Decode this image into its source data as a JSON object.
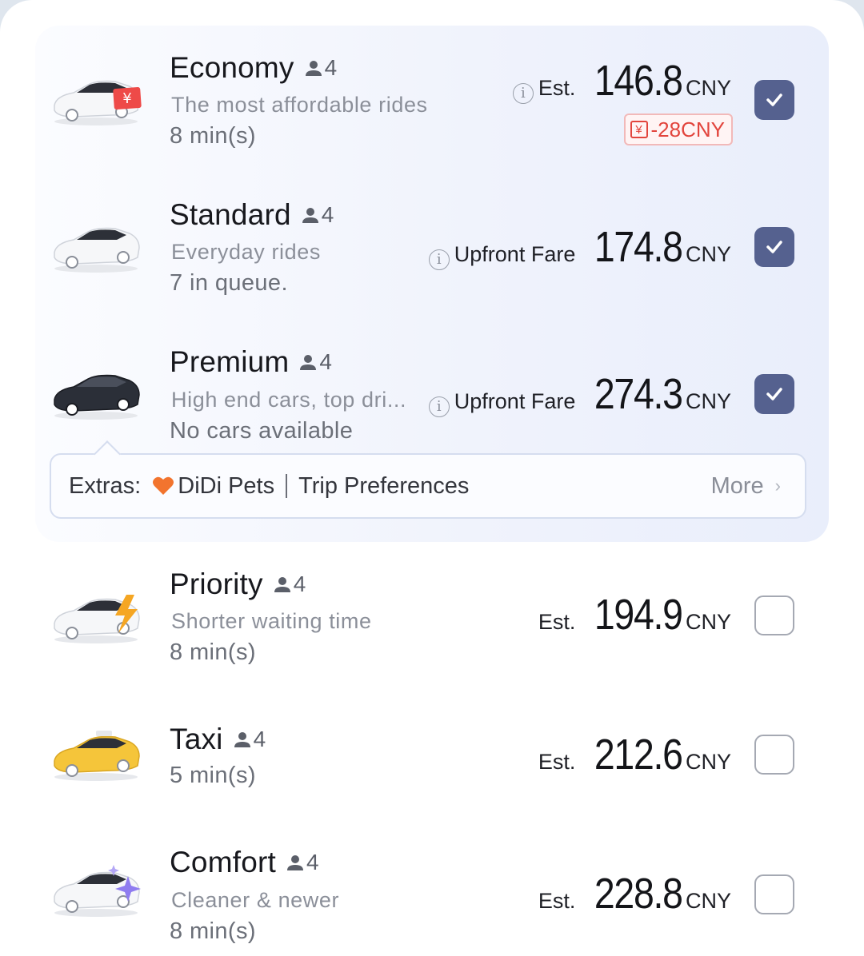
{
  "rides": [
    {
      "name": "Economy",
      "seats": "4",
      "subtitle": "The most affordable rides",
      "eta": "8 min(s)",
      "price_label": "Est.",
      "amount": "146.8",
      "currency": "CNY",
      "discount": "-28CNY",
      "discount_icon": "¥",
      "selected": true
    },
    {
      "name": "Standard",
      "seats": "4",
      "subtitle": "Everyday rides",
      "eta": "7 in queue.",
      "price_label": "Upfront Fare",
      "amount": "174.8",
      "currency": "CNY",
      "selected": true
    },
    {
      "name": "Premium",
      "seats": "4",
      "subtitle": "High end cars, top dri...",
      "eta": "No cars available",
      "price_label": "Upfront Fare",
      "amount": "274.3",
      "currency": "CNY",
      "selected": true
    },
    {
      "name": "Priority",
      "seats": "4",
      "subtitle": "Shorter waiting time",
      "eta": "8 min(s)",
      "price_label": "Est.",
      "amount": "194.9",
      "currency": "CNY",
      "selected": false
    },
    {
      "name": "Taxi",
      "seats": "4",
      "eta": "5 min(s)",
      "price_label": "Est.",
      "amount": "212.6",
      "currency": "CNY",
      "selected": false
    },
    {
      "name": "Comfort",
      "seats": "4",
      "subtitle": "Cleaner & newer",
      "eta": "8 min(s)",
      "price_label": "Est.",
      "amount": "228.8",
      "currency": "CNY",
      "selected": false
    }
  ],
  "extras": {
    "label": "Extras:",
    "pets": "DiDi Pets",
    "preferences": "Trip Preferences",
    "more": "More"
  },
  "colors": {
    "checkbox_selected": "#55618f",
    "discount_red": "#e2453d",
    "taxi_yellow": "#f5c53a",
    "premium_car": "#2b2f38",
    "pet_heart": "#f2742e"
  },
  "icons": {
    "seat": "person-icon",
    "info": "info-icon",
    "check": "check-icon",
    "heart": "heart-icon",
    "more": "chevron-right-icon"
  }
}
